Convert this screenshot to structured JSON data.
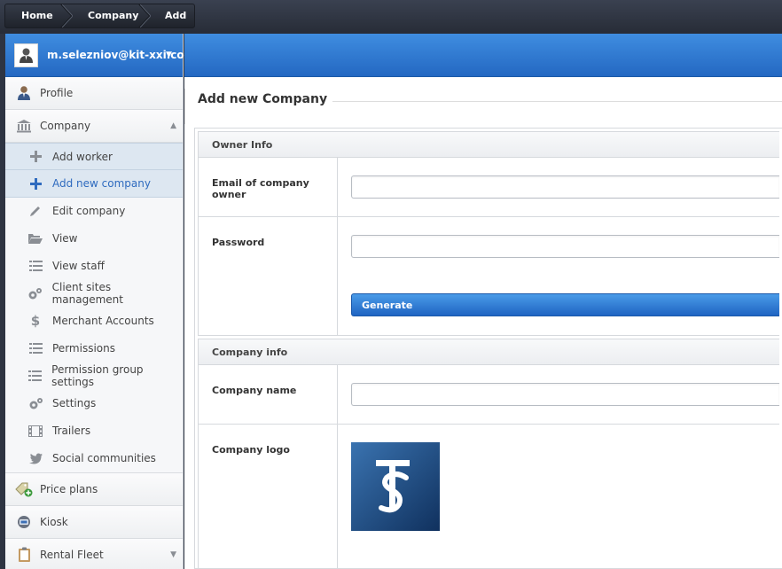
{
  "breadcrumb": [
    "Home",
    "Company",
    "Add"
  ],
  "user": {
    "email": "m.selezniov@kit-xxi.co..."
  },
  "sidebar": {
    "profile": "Profile",
    "company": "Company",
    "company_items": [
      {
        "label": "Add worker",
        "icon": "plus-icon"
      },
      {
        "label": "Add new company",
        "icon": "plus-icon"
      },
      {
        "label": "Edit company",
        "icon": "pencil-icon"
      },
      {
        "label": "View",
        "icon": "folder-open-icon"
      },
      {
        "label": "View staff",
        "icon": "list-icon"
      },
      {
        "label": "Client sites management",
        "icon": "gears-icon"
      },
      {
        "label": "Merchant Accounts",
        "icon": "dollar-icon"
      },
      {
        "label": "Permissions",
        "icon": "list-icon"
      },
      {
        "label": "Permission group settings",
        "icon": "list-icon"
      },
      {
        "label": "Settings",
        "icon": "gears-icon"
      },
      {
        "label": "Trailers",
        "icon": "film-icon"
      },
      {
        "label": "Social communities",
        "icon": "twitter-icon"
      }
    ],
    "price_plans": "Price plans",
    "kiosk": "Kiosk",
    "rental_fleet": "Rental Fleet"
  },
  "main": {
    "title": "Add new Company",
    "owner_section": "Owner Info",
    "email_label": "Email of company owner",
    "email_value": "",
    "password_label": "Password",
    "password_value": "",
    "generate_label": "Generate",
    "company_section": "Company info",
    "company_name_label": "Company name",
    "company_name_value": "",
    "company_logo_label": "Company logo"
  },
  "colors": {
    "accent_blue": "#2f7fd8",
    "active_item_text": "#2f6bbf",
    "topbar": "#2e3442"
  }
}
